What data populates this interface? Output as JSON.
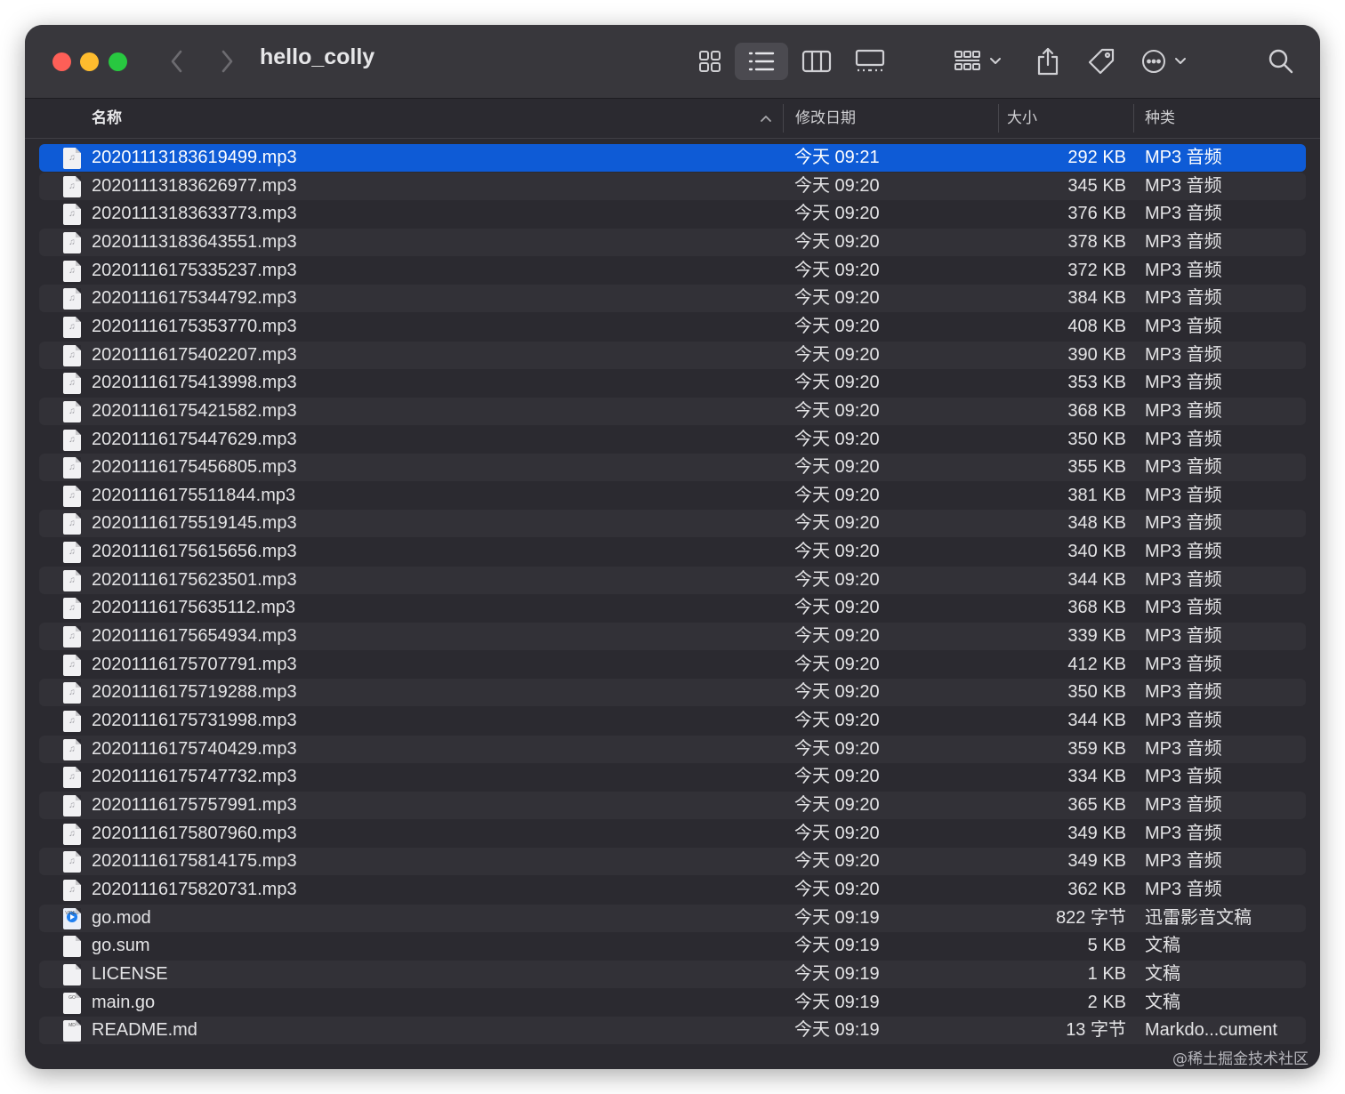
{
  "window": {
    "title": "hello_colly",
    "toolbar_icons": [
      "chevron-left-icon",
      "chevron-right-icon",
      "icon-view-icon",
      "list-view-icon",
      "column-view-icon",
      "gallery-view-icon",
      "group-icon",
      "share-icon",
      "tag-icon",
      "more-icon",
      "search-icon"
    ],
    "active_view": "list"
  },
  "columns": {
    "name": "名称",
    "date": "修改日期",
    "size": "大小",
    "kind": "种类",
    "sort_indicator": "^"
  },
  "files": [
    {
      "name": "20201113183619499.mp3",
      "date": "今天 09:21",
      "size": "292 KB",
      "kind": "MP3 音频",
      "icon": "music-file-icon",
      "selected": true
    },
    {
      "name": "20201113183626977.mp3",
      "date": "今天 09:20",
      "size": "345 KB",
      "kind": "MP3 音频",
      "icon": "music-file-icon"
    },
    {
      "name": "20201113183633773.mp3",
      "date": "今天 09:20",
      "size": "376 KB",
      "kind": "MP3 音频",
      "icon": "music-file-icon"
    },
    {
      "name": "20201113183643551.mp3",
      "date": "今天 09:20",
      "size": "378 KB",
      "kind": "MP3 音频",
      "icon": "music-file-icon"
    },
    {
      "name": "20201116175335237.mp3",
      "date": "今天 09:20",
      "size": "372 KB",
      "kind": "MP3 音频",
      "icon": "music-file-icon"
    },
    {
      "name": "20201116175344792.mp3",
      "date": "今天 09:20",
      "size": "384 KB",
      "kind": "MP3 音频",
      "icon": "music-file-icon"
    },
    {
      "name": "20201116175353770.mp3",
      "date": "今天 09:20",
      "size": "408 KB",
      "kind": "MP3 音频",
      "icon": "music-file-icon"
    },
    {
      "name": "20201116175402207.mp3",
      "date": "今天 09:20",
      "size": "390 KB",
      "kind": "MP3 音频",
      "icon": "music-file-icon"
    },
    {
      "name": "20201116175413998.mp3",
      "date": "今天 09:20",
      "size": "353 KB",
      "kind": "MP3 音频",
      "icon": "music-file-icon"
    },
    {
      "name": "20201116175421582.mp3",
      "date": "今天 09:20",
      "size": "368 KB",
      "kind": "MP3 音频",
      "icon": "music-file-icon"
    },
    {
      "name": "20201116175447629.mp3",
      "date": "今天 09:20",
      "size": "350 KB",
      "kind": "MP3 音频",
      "icon": "music-file-icon"
    },
    {
      "name": "20201116175456805.mp3",
      "date": "今天 09:20",
      "size": "355 KB",
      "kind": "MP3 音频",
      "icon": "music-file-icon"
    },
    {
      "name": "20201116175511844.mp3",
      "date": "今天 09:20",
      "size": "381 KB",
      "kind": "MP3 音频",
      "icon": "music-file-icon"
    },
    {
      "name": "20201116175519145.mp3",
      "date": "今天 09:20",
      "size": "348 KB",
      "kind": "MP3 音频",
      "icon": "music-file-icon"
    },
    {
      "name": "20201116175615656.mp3",
      "date": "今天 09:20",
      "size": "340 KB",
      "kind": "MP3 音频",
      "icon": "music-file-icon"
    },
    {
      "name": "20201116175623501.mp3",
      "date": "今天 09:20",
      "size": "344 KB",
      "kind": "MP3 音频",
      "icon": "music-file-icon"
    },
    {
      "name": "20201116175635112.mp3",
      "date": "今天 09:20",
      "size": "368 KB",
      "kind": "MP3 音频",
      "icon": "music-file-icon"
    },
    {
      "name": "20201116175654934.mp3",
      "date": "今天 09:20",
      "size": "339 KB",
      "kind": "MP3 音频",
      "icon": "music-file-icon"
    },
    {
      "name": "20201116175707791.mp3",
      "date": "今天 09:20",
      "size": "412 KB",
      "kind": "MP3 音频",
      "icon": "music-file-icon"
    },
    {
      "name": "20201116175719288.mp3",
      "date": "今天 09:20",
      "size": "350 KB",
      "kind": "MP3 音频",
      "icon": "music-file-icon"
    },
    {
      "name": "20201116175731998.mp3",
      "date": "今天 09:20",
      "size": "344 KB",
      "kind": "MP3 音频",
      "icon": "music-file-icon"
    },
    {
      "name": "20201116175740429.mp3",
      "date": "今天 09:20",
      "size": "359 KB",
      "kind": "MP3 音频",
      "icon": "music-file-icon"
    },
    {
      "name": "20201116175747732.mp3",
      "date": "今天 09:20",
      "size": "334 KB",
      "kind": "MP3 音频",
      "icon": "music-file-icon"
    },
    {
      "name": "20201116175757991.mp3",
      "date": "今天 09:20",
      "size": "365 KB",
      "kind": "MP3 音频",
      "icon": "music-file-icon"
    },
    {
      "name": "20201116175807960.mp3",
      "date": "今天 09:20",
      "size": "349 KB",
      "kind": "MP3 音频",
      "icon": "music-file-icon"
    },
    {
      "name": "20201116175814175.mp3",
      "date": "今天 09:20",
      "size": "349 KB",
      "kind": "MP3 音频",
      "icon": "music-file-icon"
    },
    {
      "name": "20201116175820731.mp3",
      "date": "今天 09:20",
      "size": "362 KB",
      "kind": "MP3 音频",
      "icon": "music-file-icon"
    },
    {
      "name": "go.mod",
      "date": "今天 09:19",
      "size": "822 字节",
      "kind": "迅雷影音文稿",
      "icon": "video-file-icon",
      "icon_label": "VIDEO"
    },
    {
      "name": "go.sum",
      "date": "今天 09:19",
      "size": "5 KB",
      "kind": "文稿",
      "icon": "document-file-icon"
    },
    {
      "name": "LICENSE",
      "date": "今天 09:19",
      "size": "1 KB",
      "kind": "文稿",
      "icon": "document-file-icon"
    },
    {
      "name": "main.go",
      "date": "今天 09:19",
      "size": "2 KB",
      "kind": "文稿",
      "icon": "go-file-icon",
      "icon_label": "GO"
    },
    {
      "name": "README.md",
      "date": "今天 09:19",
      "size": "13 字节",
      "kind": "Markdo...cument",
      "icon": "markdown-file-icon",
      "icon_label": "MD"
    }
  ],
  "watermark": "@稀土掘金技术社区",
  "colors": {
    "selection": "#0e5bd6",
    "window_bg": "#2b2a30",
    "toolbar_bg": "#38373c",
    "close": "#fe5f57",
    "minimize": "#febc2e",
    "zoom": "#28c840"
  }
}
